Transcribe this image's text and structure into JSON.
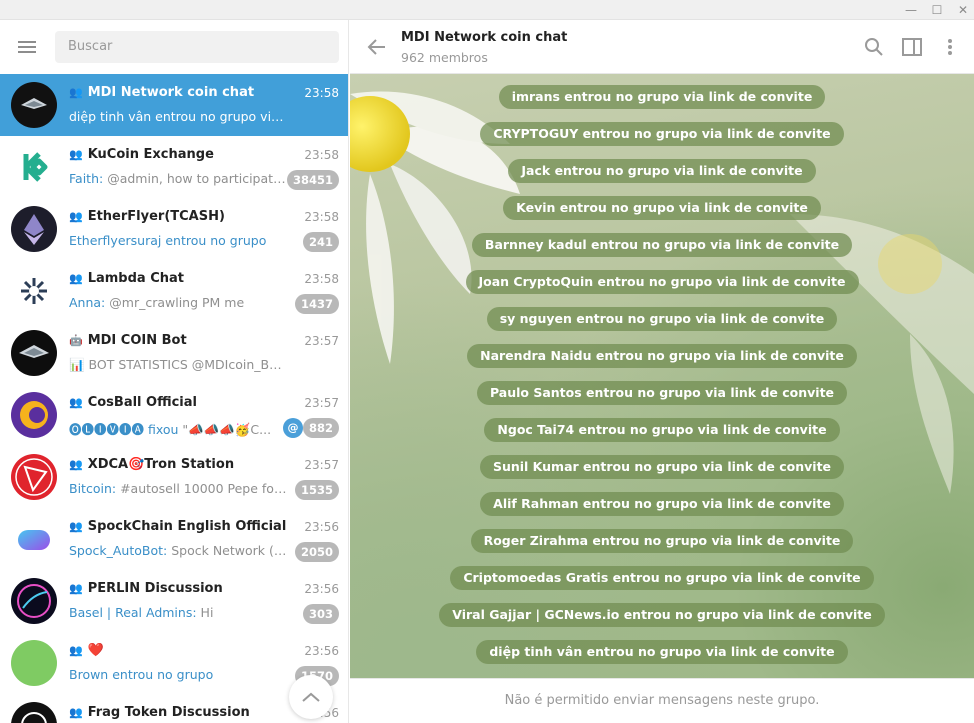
{
  "search": {
    "placeholder": "Buscar"
  },
  "chats": [
    {
      "name": "MDI Network coin chat",
      "time": "23:58",
      "preview_sender": "",
      "preview": "diệp tinh vân entrou no grupo via link de co...",
      "badge": "",
      "active": true
    },
    {
      "name": "KuCoin Exchange",
      "time": "23:58",
      "preview_sender": "Faith:",
      "preview": "@admin, how to participate s...",
      "badge": "38451"
    },
    {
      "name": "EtherFlyer(TCASH)",
      "time": "23:58",
      "preview_sender": "Etherflyersuraj entrou no grupo",
      "preview": "",
      "badge": "241"
    },
    {
      "name": "Lambda Chat",
      "time": "23:58",
      "preview_sender": "Anna:",
      "preview": "@mr_crawling PM me",
      "badge": "1437"
    },
    {
      "name": "MDI COIN Bot",
      "time": "23:57",
      "preview_sender": "",
      "preview": "📊 BOT STATISTICS @MDIcoin_Bot ◾ Cre...",
      "badge": ""
    },
    {
      "name": "CosBall Official",
      "time": "23:57",
      "preview_sender": "🅞🅛🅘🅥🅘🅐 fixou",
      "preview": "\"📣📣📣🥳C...",
      "badge": "882",
      "mention": "@"
    },
    {
      "name": "XDCA🎯Tron Station",
      "time": "23:57",
      "preview_sender": "Bitcoin:",
      "preview": "#autosell 10000 Pepe for 5 T...",
      "badge": "1535"
    },
    {
      "name": "SpockChain English Official",
      "time": "23:56",
      "preview_sender": "Spock_AutoBot:",
      "preview": "Spock Network (ww...",
      "badge": "2050"
    },
    {
      "name": "PERLIN Discussion",
      "time": "23:56",
      "preview_sender": "Basel | Real Admins:",
      "preview": "Hi",
      "badge": "303"
    },
    {
      "name": "❤️",
      "time": "23:56",
      "preview_sender": "Brown entrou no grupo",
      "preview": "",
      "badge": "1570"
    },
    {
      "name": "Frag Token Discussion",
      "time": "23:56",
      "preview_sender": "",
      "preview": "",
      "badge": ""
    }
  ],
  "header": {
    "title": "MDI Network coin chat",
    "subtitle": "962 membros"
  },
  "messages": [
    "imrans entrou no grupo via link de convite",
    "CRYPTOGUY entrou no grupo via link de convite",
    "Jack entrou no grupo via link de convite",
    "Kevin entrou no grupo via link de convite",
    "Barnney kadul entrou no grupo via link de convite",
    "Joan CryptoQuin entrou no grupo via link de convite",
    "sy nguyen entrou no grupo via link de convite",
    "Narendra Naidu entrou no grupo via link de convite",
    "Paulo Santos entrou no grupo via link de convite",
    "Ngoc Tai74 entrou no grupo via link de convite",
    "Sunil Kumar entrou no grupo via link de convite",
    "Alif Rahman entrou no grupo via link de convite",
    "Roger Zirahma entrou no grupo via link de convite",
    "Criptomoedas Gratis entrou no grupo via link de convite",
    "Viral Gajjar | GCNews.io entrou no grupo via link de convite",
    "diệp tinh vân entrou no grupo via link de convite"
  ],
  "footer": {
    "notice": "Não é permitido enviar mensagens neste grupo."
  },
  "icons": {
    "group": "group-icon",
    "bot": "bot-icon"
  },
  "colors": {
    "accent": "#419fd9",
    "badge": "#b8b8b8",
    "link": "#3a8fc8"
  }
}
